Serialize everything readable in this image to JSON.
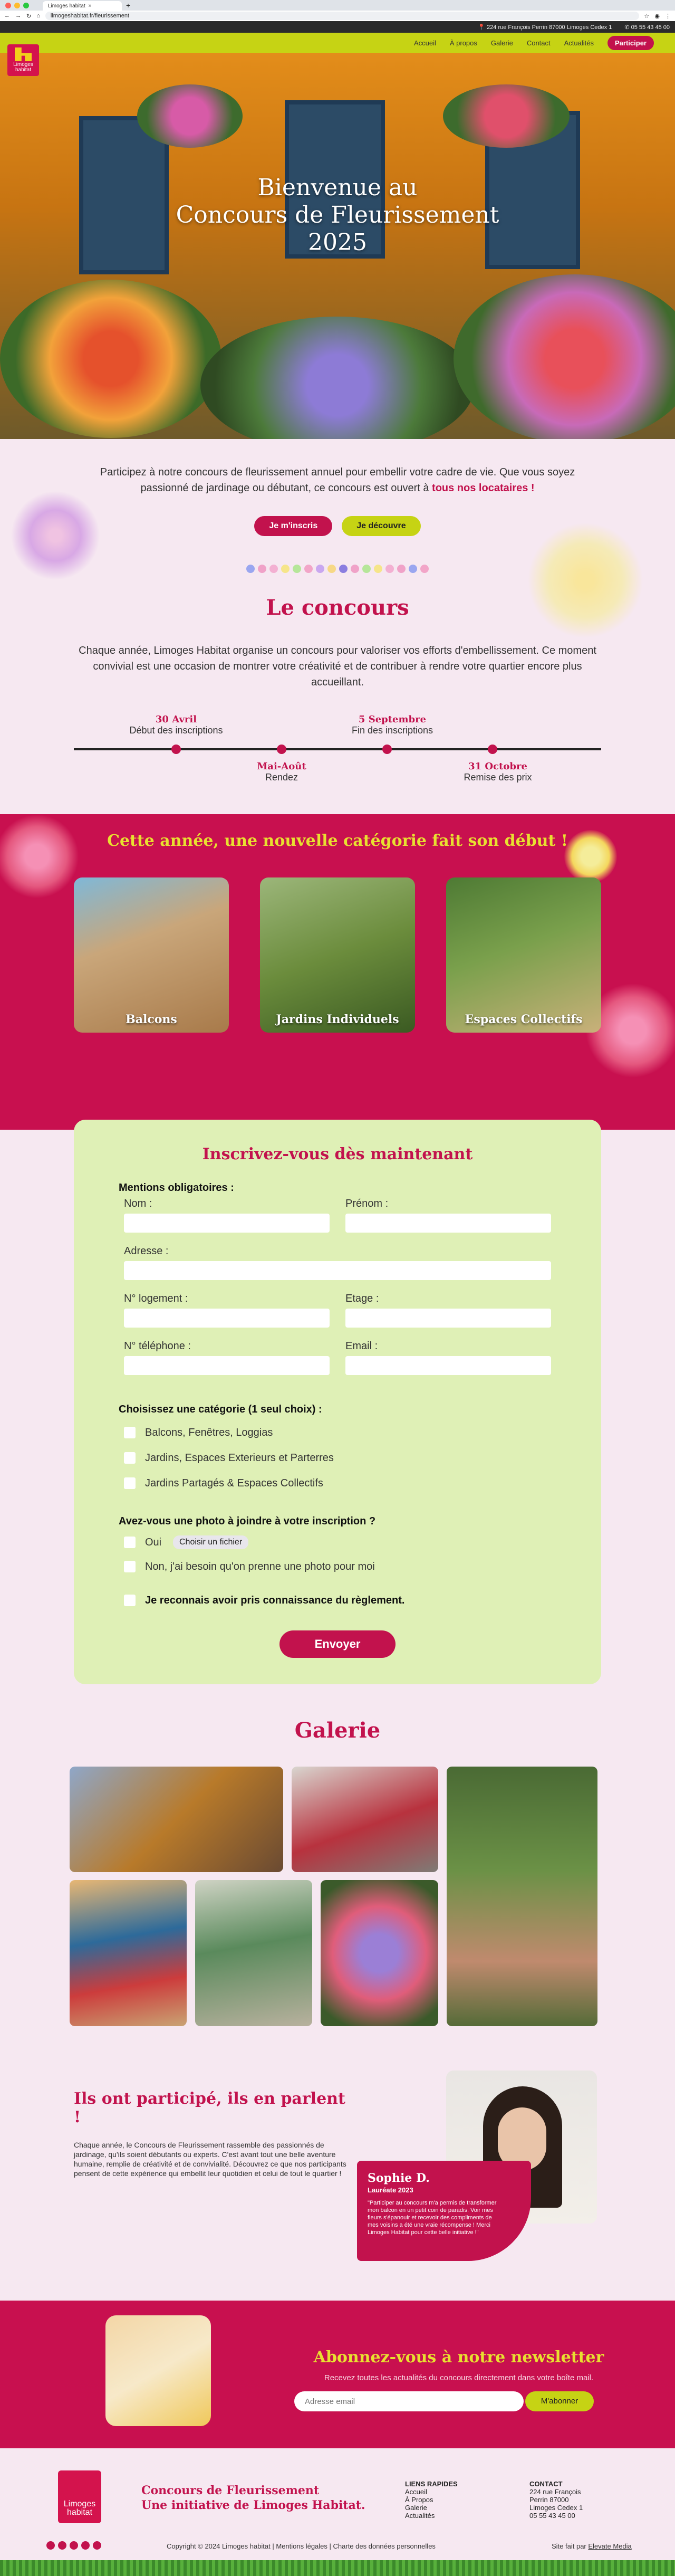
{
  "browser": {
    "tab_title": "Limoges habitat",
    "url": "limogeshabitat.fr/fleurissement"
  },
  "topbar": {
    "address": "224 rue François Perrin 87000 Limoges Cedex 1",
    "phone": "05 55 43 45 00"
  },
  "nav": {
    "items": [
      "Accueil",
      "À propos",
      "Galerie",
      "Contact",
      "Actualités"
    ],
    "cta": "Participer"
  },
  "logo": {
    "text": "Limoges habitat"
  },
  "hero": {
    "title_line1": "Bienvenue au",
    "title_line2": "Concours de Fleurissement",
    "title_line3": "2025"
  },
  "intro": {
    "text": "Participez à notre concours de fleurissement annuel pour embellir votre cadre de vie. Que vous soyez passionné de jardinage ou débutant, ce concours est ouvert à ",
    "highlight": "tous nos locataires !",
    "btn_register": "Je m'inscris",
    "btn_discover": "Je découvre"
  },
  "concours": {
    "title": "Le concours",
    "text": "Chaque année, Limoges Habitat organise un concours pour valoriser vos efforts d'embellissement. Ce moment convivial est une occasion de montrer votre créativité et de contribuer à rendre votre quartier encore plus accueillant.",
    "timeline": [
      {
        "date": "30 Avril",
        "label": "Début des inscriptions"
      },
      {
        "date": "Mai-Août",
        "label": "Rendez"
      },
      {
        "date": "5 Septembre",
        "label": "Fin des inscriptions"
      },
      {
        "date": "31 Octobre",
        "label": "Remise des prix"
      }
    ]
  },
  "categories": {
    "title": "Cette année, une nouvelle catégorie fait son début !",
    "items": [
      "Balcons",
      "Jardins Individuels",
      "Espaces Collectifs"
    ]
  },
  "form": {
    "title": "Inscrivez-vous dès maintenant",
    "mandatory": "Mentions obligatoires :",
    "nom": "Nom :",
    "prenom": "Prénom :",
    "adresse": "Adresse :",
    "logement": "N° logement :",
    "etage": "Etage :",
    "telephone": "N° téléphone :",
    "email": "Email :",
    "category_q": "Choisissez une catégorie (1 seul choix) :",
    "cat_options": [
      "Balcons, Fenêtres, Loggias",
      "Jardins, Espaces Exterieurs et Parterres",
      "Jardins Partagés & Espaces Collectifs"
    ],
    "photo_q": "Avez-vous une photo à joindre à votre inscription ?",
    "photo_yes": "Oui",
    "file_btn": "Choisir un fichier",
    "photo_no": "Non, j'ai besoin qu'on prenne une photo pour moi",
    "rules": "Je reconnais avoir pris connaissance du règlement.",
    "submit": "Envoyer"
  },
  "gallery": {
    "title": "Galerie"
  },
  "testimonials": {
    "title": "Ils ont participé, ils en parlent !",
    "text": "Chaque année, le Concours de Fleurissement rassemble des passionnés de jardinage, qu'ils soient débutants ou experts. C'est avant tout une belle aventure humaine, remplie de créativité et de convivialité. Découvrez ce que nos participants pensent de cette expérience qui embellit leur quotidien et celui de tout le quartier !",
    "name": "Sophie D.",
    "role": "Lauréate 2023",
    "quote": "\"Participer au concours m'a permis de transformer mon balcon en un petit coin de paradis. Voir mes fleurs s'épanouir et recevoir des compliments de mes voisins a été une vraie récompense ! Merci Limoges Habitat pour cette belle initiative !\""
  },
  "newsletter": {
    "title": "Abonnez-vous à notre newsletter",
    "subtitle": "Recevez toutes les actualités du concours directement dans votre boîte mail.",
    "placeholder": "Adresse email",
    "button": "M'abonner"
  },
  "footer": {
    "title_line1": "Concours de Fleurissement",
    "title_line2": "Une initiative de Limoges Habitat.",
    "links_title": "LIENS RAPIDES",
    "links": [
      "Accueil",
      "À Propos",
      "Galerie",
      "Actualités"
    ],
    "contact_title": "CONTACT",
    "contact": [
      "224 rue François",
      "Perrin 87000",
      "Limoges Cedex 1",
      "05 55 43 45 00"
    ],
    "copyright": "Copyright © 2024 Limoges habitat | Mentions légales | Charte des données personnelles",
    "made_by": "Site fait par ",
    "agency": "Elevate Media"
  },
  "colors": {
    "primary": "#c2124d",
    "accent": "#c6d314",
    "background": "#f6e8f1",
    "form_bg": "#dff0b6"
  }
}
